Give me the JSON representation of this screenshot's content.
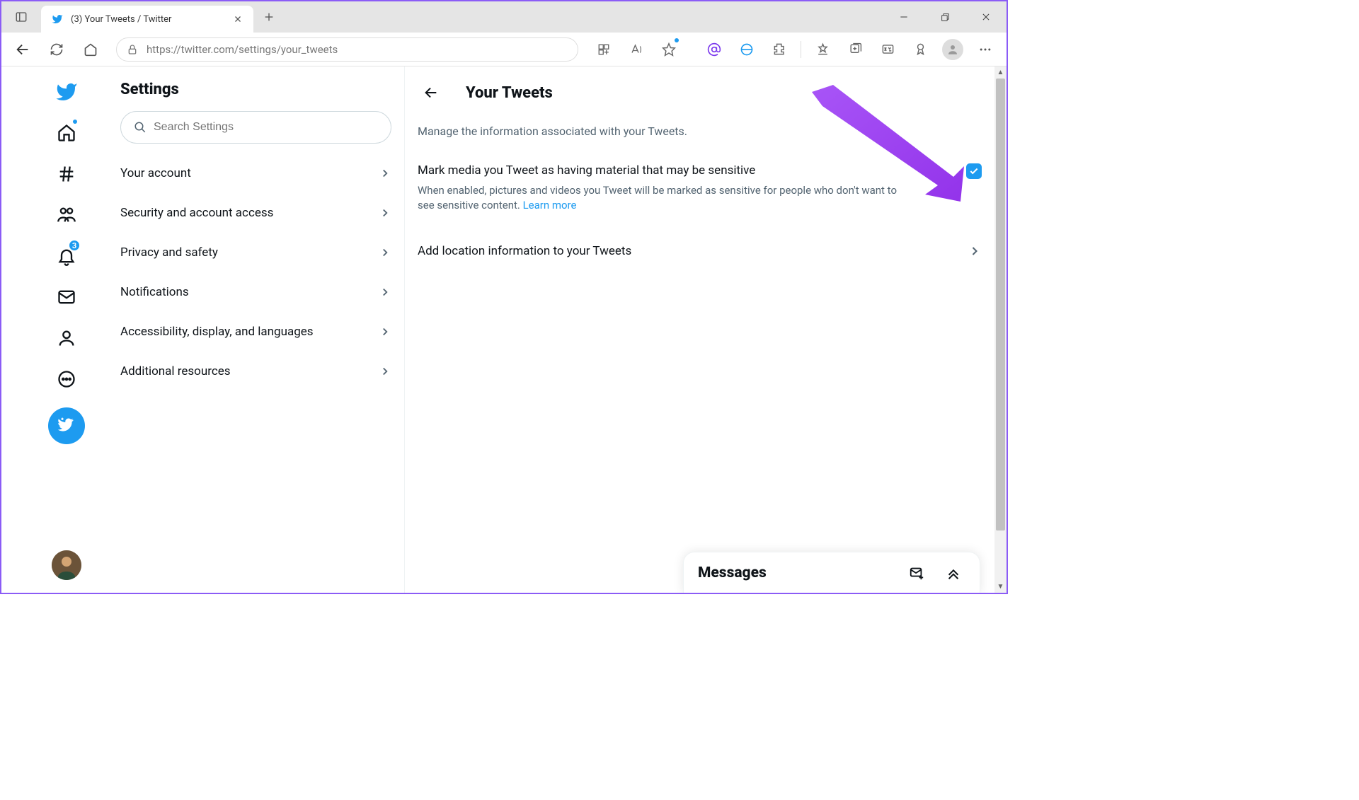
{
  "browser": {
    "tab_title": "(3) Your Tweets / Twitter",
    "url": "https://twitter.com/settings/your_tweets"
  },
  "nav": {
    "notifications_badge": "3"
  },
  "settings": {
    "title": "Settings",
    "search_placeholder": "Search Settings",
    "items": [
      {
        "label": "Your account"
      },
      {
        "label": "Security and account access"
      },
      {
        "label": "Privacy and safety"
      },
      {
        "label": "Notifications"
      },
      {
        "label": "Accessibility, display, and languages"
      },
      {
        "label": "Additional resources"
      }
    ]
  },
  "detail": {
    "title": "Your Tweets",
    "description": "Manage the information associated with your Tweets.",
    "sensitive": {
      "title": "Mark media you Tweet as having material that may be sensitive",
      "description": "When enabled, pictures and videos you Tweet will be marked as sensitive for people who don't want to see sensitive content. ",
      "learn_more": "Learn more",
      "checked": true
    },
    "location": {
      "title": "Add location information to your Tweets"
    }
  },
  "messages": {
    "title": "Messages"
  }
}
